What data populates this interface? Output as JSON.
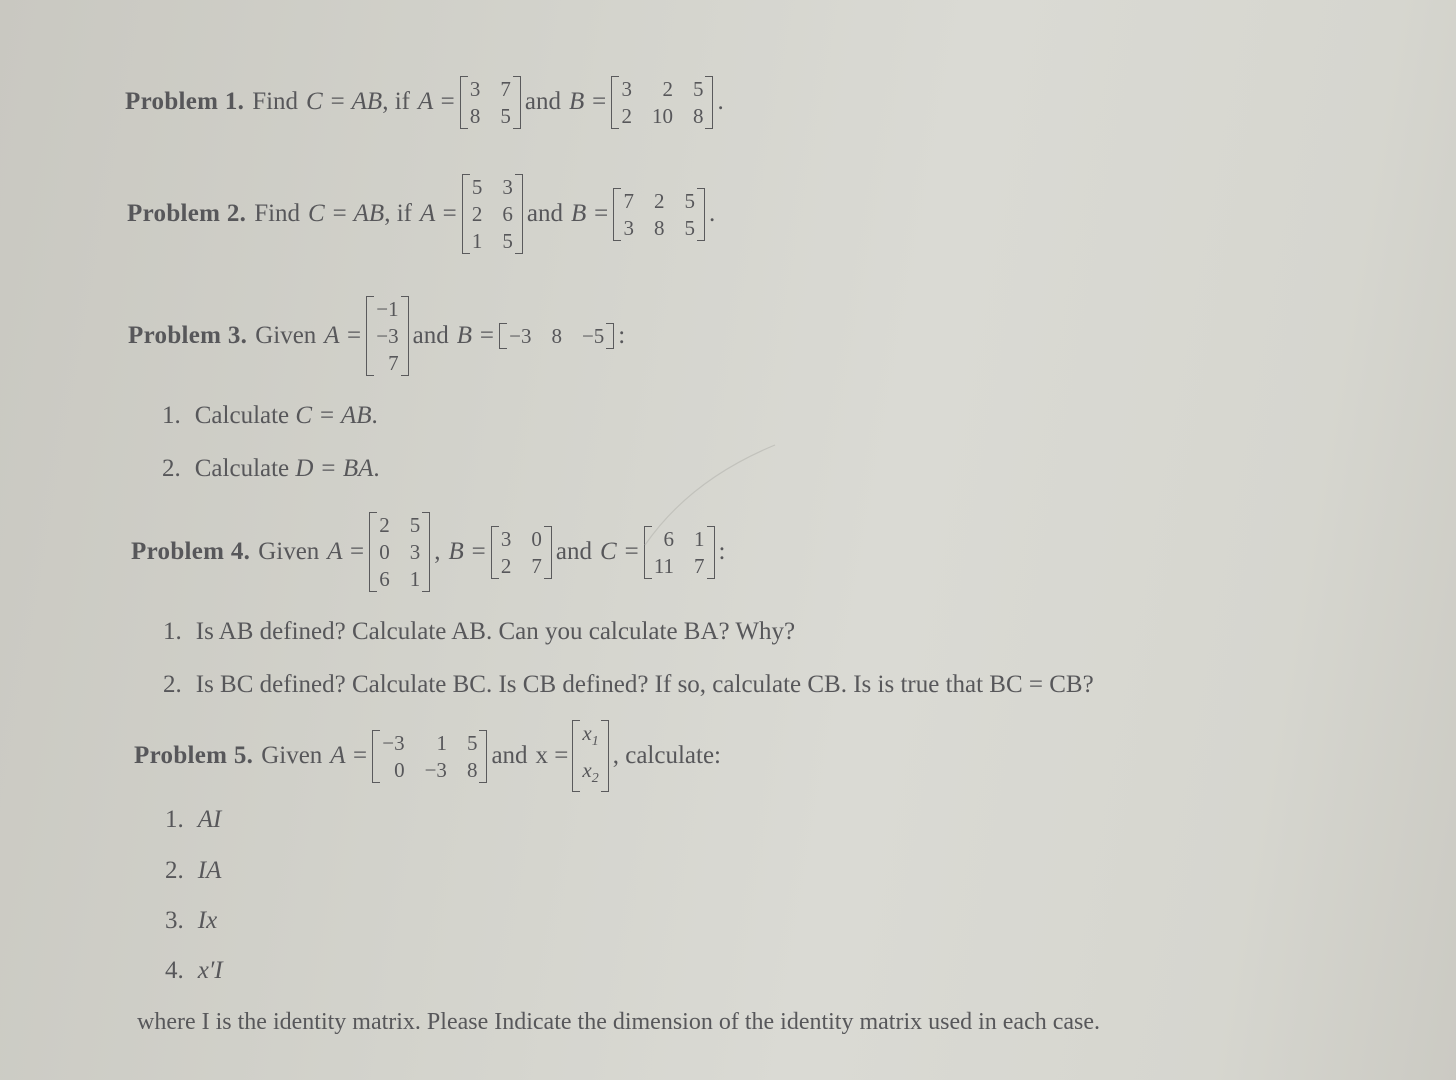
{
  "problems": [
    {
      "label": "Problem 1.",
      "intro": "Find",
      "equation": "C = AB",
      "cond": ", if",
      "a_label": "A =",
      "a_matrix": [
        [
          "3",
          "7"
        ],
        [
          "8",
          "5"
        ]
      ],
      "joiner": "and",
      "b_label": "B =",
      "b_matrix": [
        [
          "3",
          "2",
          "5"
        ],
        [
          "2",
          "10",
          "8"
        ]
      ],
      "end": "."
    },
    {
      "label": "Problem 2.",
      "intro": "Find",
      "equation": "C = AB",
      "cond": ", if",
      "a_label": "A =",
      "a_matrix": [
        [
          "5",
          "3"
        ],
        [
          "2",
          "6"
        ],
        [
          "1",
          "5"
        ]
      ],
      "joiner": "and",
      "b_label": "B =",
      "b_matrix": [
        [
          "7",
          "2",
          "5"
        ],
        [
          "3",
          "8",
          "5"
        ]
      ],
      "end": "."
    },
    {
      "label": "Problem 3.",
      "intro": "Given",
      "a_label": "A =",
      "a_matrix": [
        [
          "−1"
        ],
        [
          "−3"
        ],
        [
          "7"
        ]
      ],
      "joiner": "and",
      "b_label": "B =",
      "b_matrix": [
        [
          "−3",
          "8",
          "−5"
        ]
      ],
      "end": ":",
      "items": [
        {
          "num": "1.",
          "text": "Calculate ",
          "math": "C = AB",
          "end": "."
        },
        {
          "num": "2.",
          "text": "Calculate ",
          "math": "D = BA",
          "end": "."
        }
      ]
    },
    {
      "label": "Problem 4.",
      "intro": "Given",
      "a_label": "A =",
      "a_matrix": [
        [
          "2",
          "5"
        ],
        [
          "0",
          "3"
        ],
        [
          "6",
          "1"
        ]
      ],
      "sep": ",",
      "b_label": "B =",
      "b_matrix": [
        [
          "3",
          "0"
        ],
        [
          "2",
          "7"
        ]
      ],
      "joiner": "and",
      "c_label": "C =",
      "c_matrix": [
        [
          "6",
          "1"
        ],
        [
          "11",
          "7"
        ]
      ],
      "end": ":",
      "items": [
        {
          "num": "1.",
          "text": "Is AB defined? Calculate AB. Can you calculate BA? Why?"
        },
        {
          "num": "2.",
          "text": "Is BC defined? Calculate BC. Is CB defined? If so, calculate CB. Is is true that BC = CB?"
        }
      ]
    },
    {
      "label": "Problem 5.",
      "intro": "Given",
      "a_label": "A =",
      "a_matrix": [
        [
          "−3",
          "1",
          "5"
        ],
        [
          "0",
          "−3",
          "8"
        ]
      ],
      "joiner": "and",
      "x_label": "x =",
      "x_vector": [
        "x1",
        "x2"
      ],
      "end": ", calculate:",
      "items": [
        {
          "num": "1.",
          "math": "AI"
        },
        {
          "num": "2.",
          "math": "IA"
        },
        {
          "num": "3.",
          "math": "Ix"
        },
        {
          "num": "4.",
          "math": "x′I"
        }
      ],
      "footer": "where I is the identity matrix. Please Indicate the dimension of the identity matrix used in each case."
    }
  ]
}
